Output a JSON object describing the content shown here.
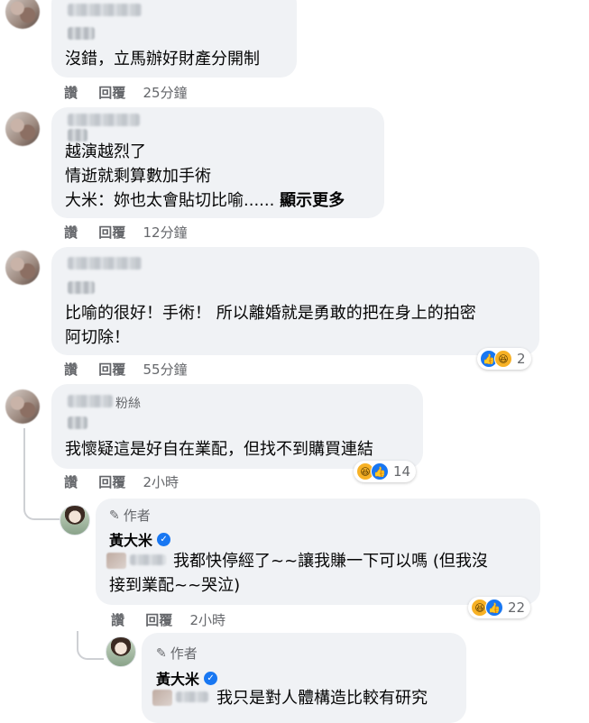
{
  "comments": [
    {
      "text_lines": [
        "沒錯，立馬辦好財產分開制"
      ],
      "actions": {
        "like": "讚",
        "reply": "回覆",
        "time": "25分鐘"
      }
    },
    {
      "text_lines": [
        "越演越烈了",
        "情逝就剩算數加手術",
        "大米：妳也太會貼切比喻......"
      ],
      "see_more": "顯示更多",
      "actions": {
        "like": "讚",
        "reply": "回覆",
        "time": "12分鐘"
      }
    },
    {
      "text_lines": [
        "比喻的很好！手術！ 所以離婚就是勇敢的把在身上的拍密",
        "阿切除！"
      ],
      "reactions": {
        "icons": [
          "like-icon",
          "haha-icon"
        ],
        "count": "2"
      },
      "actions": {
        "like": "讚",
        "reply": "回覆",
        "time": "55分鐘"
      }
    },
    {
      "name_suffix": "粉絲",
      "text_lines": [
        "我懷疑這是好自在業配，但找不到購買連結"
      ],
      "reactions": {
        "icons": [
          "haha-icon",
          "like-icon"
        ],
        "count": "14"
      },
      "actions": {
        "like": "讚",
        "reply": "回覆",
        "time": "2小時"
      }
    }
  ],
  "replies": [
    {
      "author_label": "作者",
      "author_name": "黃大米",
      "text_lines": [
        "我都快停經了~~讓我賺一下可以嗎 (但我沒",
        "接到業配~~哭泣)"
      ],
      "reactions": {
        "icons": [
          "haha-icon",
          "like-icon"
        ],
        "count": "22"
      },
      "actions": {
        "like": "讚",
        "reply": "回覆",
        "time": "2小時"
      }
    },
    {
      "author_label": "作者",
      "author_name": "黃大米",
      "text_lines": [
        "我只是對人體構造比較有研究"
      ]
    }
  ],
  "colors": {
    "like": "#1877f2",
    "haha": "#f7b125",
    "bubble": "#f0f2f5",
    "meta": "#65676b"
  }
}
